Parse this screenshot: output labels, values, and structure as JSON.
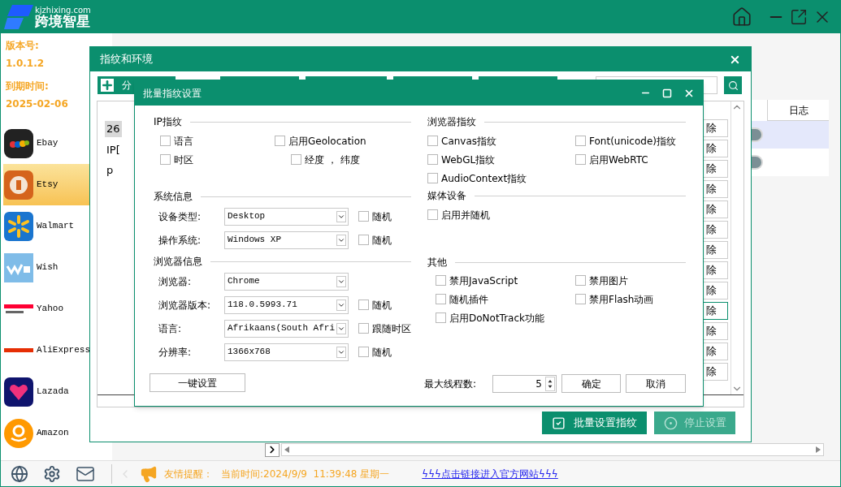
{
  "app": {
    "domain": "kjzhixing.com",
    "name": "跨境智星"
  },
  "sidebar": {
    "version_label": "版本号:",
    "version": "1.0.1.2",
    "expiry_label": "到期时间:",
    "expiry": "2025-02-06",
    "platforms": [
      {
        "name": "Ebay",
        "selected": false
      },
      {
        "name": "Etsy",
        "selected": true
      },
      {
        "name": "Walmart",
        "selected": false
      },
      {
        "name": "Wish",
        "selected": false
      },
      {
        "name": "Yahoo",
        "selected": false
      },
      {
        "name": "AliExpress",
        "selected": false
      },
      {
        "name": "Lazada",
        "selected": false
      },
      {
        "name": "Amazon",
        "selected": false
      }
    ]
  },
  "main_table": {
    "columns": [
      {
        "label": "日志"
      }
    ],
    "rows": [
      {
        "selected": true
      },
      {
        "selected": false
      }
    ]
  },
  "env_window": {
    "title": "指纹和环境",
    "first_button": "分",
    "cells": [
      "26",
      "IP[",
      "p"
    ],
    "delete_buttons": [
      {
        "label": "除",
        "focused": false
      },
      {
        "label": "除",
        "focused": false
      },
      {
        "label": "除",
        "focused": false
      },
      {
        "label": "除",
        "focused": false
      },
      {
        "label": "除",
        "focused": false
      },
      {
        "label": "除",
        "focused": false
      },
      {
        "label": "除",
        "focused": false
      },
      {
        "label": "除",
        "focused": false
      },
      {
        "label": "除",
        "focused": false
      },
      {
        "label": "除",
        "focused": true
      },
      {
        "label": "除",
        "focused": false
      },
      {
        "label": "除",
        "focused": false
      },
      {
        "label": "除",
        "focused": false
      }
    ],
    "batch_button": "批量设置指纹",
    "stop_button": {
      "label": "停止设置",
      "disabled": true
    }
  },
  "dialog": {
    "title": "批量指纹设置",
    "ip_section": {
      "title": "IP指纹",
      "columns": [
        [
          {
            "label": "语言",
            "checked": false
          },
          {
            "label": "时区",
            "checked": false
          }
        ],
        [
          {
            "label": "启用Geolocation",
            "checked": false,
            "children": [
              {
                "label": "经度 ， 纬度",
                "checked": false
              }
            ]
          }
        ]
      ]
    },
    "system_section": {
      "title": "系统信息",
      "fields": [
        {
          "label": "设备类型:",
          "value": "Desktop",
          "option": {
            "label": "随机",
            "checked": false
          }
        },
        {
          "label": "操作系统:",
          "value": "Windows XP",
          "option": {
            "label": "随机",
            "checked": false
          }
        }
      ]
    },
    "browser_section": {
      "title": "浏览器信息",
      "fields": [
        {
          "label": "浏览器:",
          "value": "Chrome"
        },
        {
          "label": "浏览器版本:",
          "value": "118.0.5993.71",
          "option": {
            "label": "随机",
            "checked": false
          }
        },
        {
          "label": "语言:",
          "value": "Afrikaans(South Afri",
          "option": {
            "label": "跟随时区",
            "checked": false
          }
        },
        {
          "label": "分辨率:",
          "value": "1366x768",
          "option": {
            "label": "随机",
            "checked": false
          }
        }
      ]
    },
    "one_click_button": "一键设置",
    "fingerprint_section": {
      "title": "浏览器指纹",
      "options": [
        {
          "label": "Canvas指纹",
          "checked": false
        },
        {
          "label": "Font(unicode)指纹",
          "checked": false
        },
        {
          "label": "WebGL指纹",
          "checked": false
        },
        {
          "label": "启用WebRTC",
          "checked": false
        },
        {
          "label": "AudioContext指纹",
          "checked": false
        }
      ]
    },
    "media_section": {
      "title": "媒体设备",
      "options": [
        {
          "label": "启用并随机",
          "checked": false
        }
      ]
    },
    "other_section": {
      "title": "其他",
      "options": [
        {
          "label": "禁用JavaScript",
          "checked": false
        },
        {
          "label": "禁用图片",
          "checked": false
        },
        {
          "label": "随机插件",
          "checked": false
        },
        {
          "label": "禁用Flash动画",
          "checked": false
        },
        {
          "label": "启用DoNotTrack功能",
          "checked": false
        }
      ]
    },
    "thread_label": "最大线程数:",
    "thread_value": "5",
    "ok_button": "确定",
    "cancel_button": "取消"
  },
  "status_bar": {
    "notice_label": "友情提醒：",
    "time": "当前时间:2024/9/9  11:39:48 星期一",
    "link": "ϟϟϟ点击链接进入官方网站ϟϟϟ"
  }
}
